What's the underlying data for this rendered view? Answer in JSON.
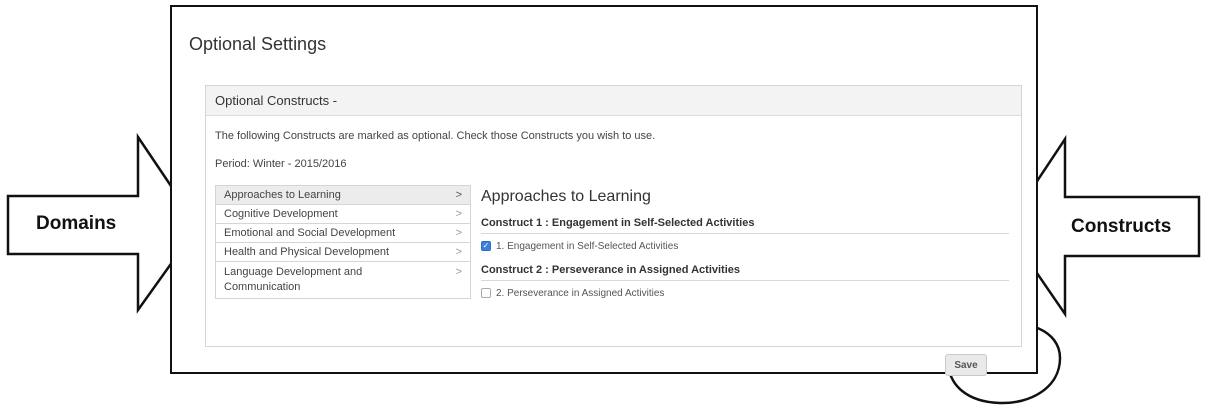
{
  "page_title": "Optional Settings",
  "panel": {
    "header": "Optional Constructs  -",
    "description": "The following Constructs are marked as optional. Check those Constructs you wish to use.",
    "period": "Period: Winter - 2015/2016"
  },
  "domains": [
    {
      "label": "Approaches to Learning",
      "active": true
    },
    {
      "label": "Cognitive Development",
      "active": false
    },
    {
      "label": "Emotional and Social Development",
      "active": false
    },
    {
      "label": "Health and Physical Development",
      "active": false
    },
    {
      "label": "Language Development and Communication",
      "active": false
    }
  ],
  "chevron": ">",
  "section_title": "Approaches to Learning",
  "constructs": [
    {
      "heading": "Construct 1 : Engagement in Self-Selected Activities",
      "item": "1. Engagement in Self-Selected Activities",
      "checked": true
    },
    {
      "heading": "Construct 2 : Perseverance in Assigned Activities",
      "item": "2. Perseverance in Assigned Activities",
      "checked": false
    }
  ],
  "save_label": "Save",
  "annotations": {
    "domains_label": "Domains",
    "constructs_label": "Constructs"
  },
  "icons": {
    "checkbox_checked": "checkbox-checked-icon",
    "checkbox_unchecked": "checkbox-unchecked-icon",
    "chevron": "chevron-right-icon"
  },
  "colors": {
    "accent": "#3d7fd9",
    "active_row": "#ececec",
    "panel_header": "#f3f3f3"
  }
}
